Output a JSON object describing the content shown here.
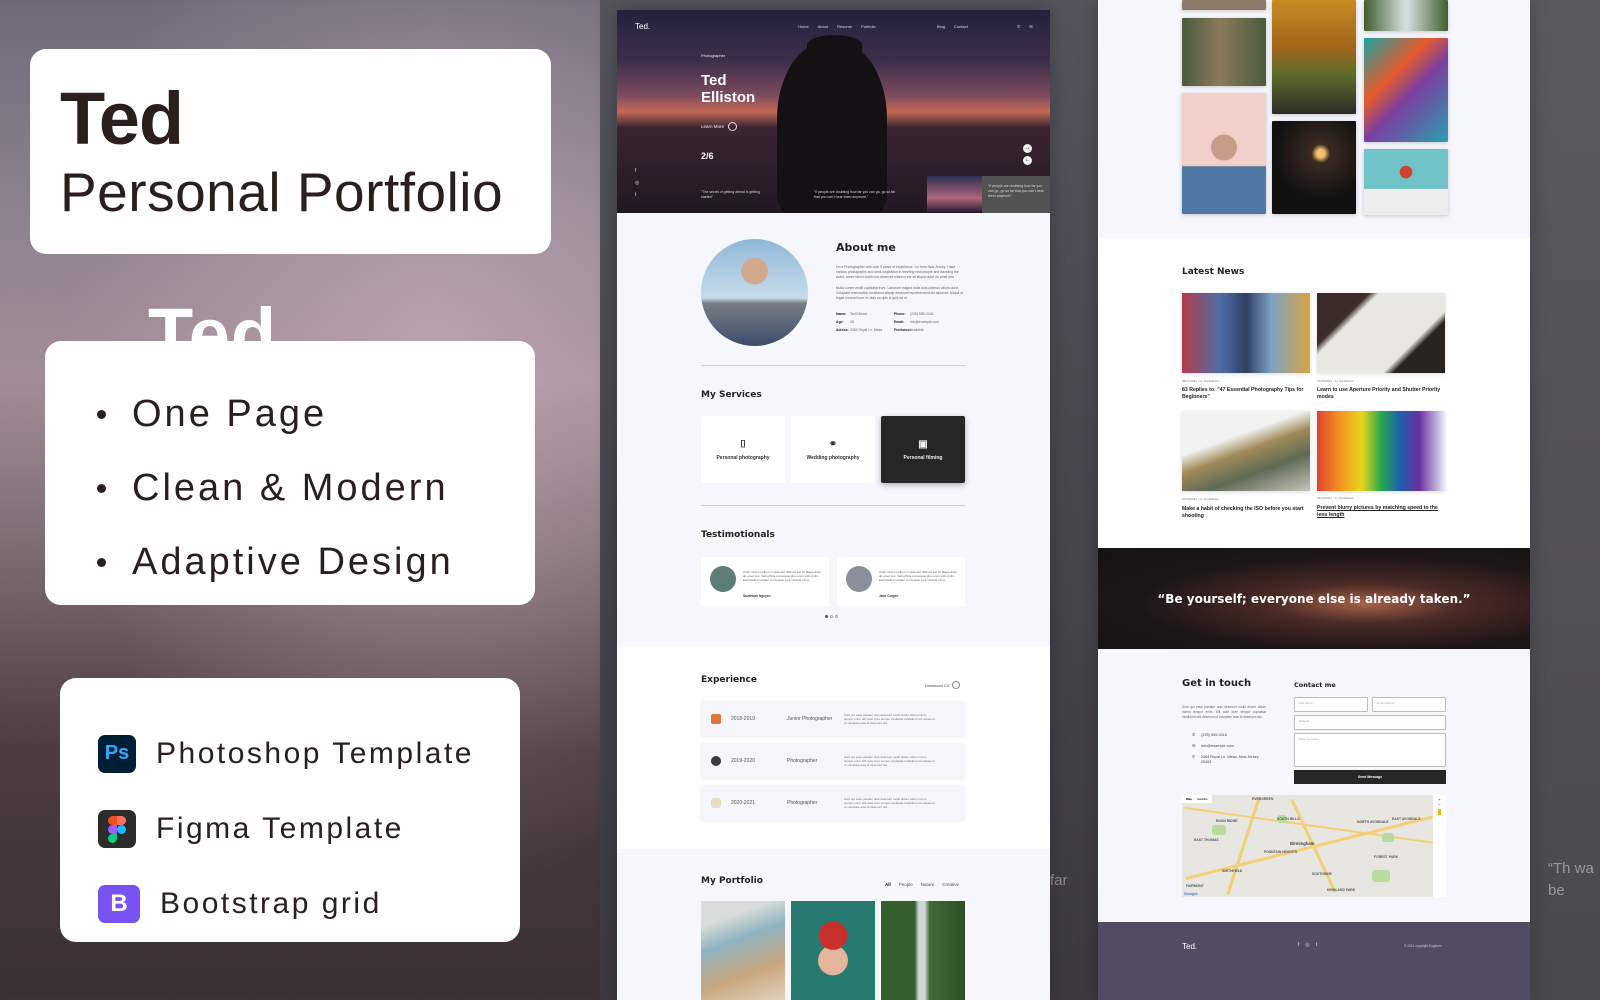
{
  "promo": {
    "title": "Ted",
    "subtitle": "Personal Portfolio",
    "ghost_title": "Ted",
    "features": [
      "One Page",
      "Clean & Modern",
      "Adaptive Design"
    ],
    "tools": [
      {
        "icon": "photoshop-icon",
        "icon_text": "Ps",
        "label": "Photoshop Template"
      },
      {
        "icon": "figma-icon",
        "icon_text": "",
        "label": "Figma Template"
      },
      {
        "icon": "bootstrap-icon",
        "icon_text": "B",
        "label": "Bootstrap grid"
      }
    ],
    "ghost_far": "far",
    "ghost_quote": "“Th wa be"
  },
  "hero": {
    "logo": "Ted.",
    "nav_left": [
      "Home",
      "About",
      "Resume",
      "Portfolio"
    ],
    "nav_right": [
      "Blog",
      "Contact"
    ],
    "role": "Photographer",
    "name": "Ted Elliston",
    "learn_more": "Learn More",
    "slide": "2/6",
    "quote_1": "\"The secret of getting ahead is getting started\"",
    "quote_2": "\"If people are doubting how far you can go, go so far that you can't hear them anymore.\"",
    "quote_3": "\"If people are doubting how far you can go, go so far that you can't hear them anymore\"",
    "social": [
      "f",
      "◎",
      "t"
    ],
    "arrow_next": "→",
    "arrow_prev": "←"
  },
  "about": {
    "title": "About me",
    "para1": "I'm a Photographer with over 5 years of experience. I'm from New Jersey, I take various photographs and seek inspiration in meeting new people and traveling the world. Amet minim mollit non deserunt ullamco est sit aliqua dolor do amet sint.",
    "para2": "Nulla Lorem mollit cupidatat irure. Laborum magna nulla duis ullamco cillum dolor. Voluptate exercitation incididunt aliquip deserunt reprehenderit elit laborum. Aliqua id fugiat nostrud irure ex duis ea quis id quis ad et.",
    "info": [
      {
        "k": "Name:",
        "v": "Ted Elliston",
        "k2": "Phone:",
        "v2": "(225) 555-0118"
      },
      {
        "k": "Age:",
        "v": "28",
        "k2": "Email:",
        "v2": "info@example.com"
      },
      {
        "k": "Adress:",
        "v": "2464 Royal Ln. Mesa",
        "k2": "Freelance:",
        "v2": "Available"
      }
    ]
  },
  "services": {
    "title": "My Services",
    "items": [
      {
        "icon": "camera-icon",
        "glyph": "📷",
        "label": "Personal photography"
      },
      {
        "icon": "wedding-couple-icon",
        "glyph": "👫",
        "label": "Wedding photography"
      },
      {
        "icon": "video-camera-icon",
        "glyph": "🎥",
        "label": "Personal filming"
      }
    ]
  },
  "testimonials": {
    "title": "Testimotionals",
    "items": [
      {
        "text": "Amet minim mollit non deserunt ullamco est sit aliqua dolor do amet sint. Velit officia consequat duis enim velit mollit. Exercitation veniam consequat sunt nostrud amet.",
        "name": "Savannah Nguyen"
      },
      {
        "text": "Amet minim mollit non deserunt ullamco est sit aliqua dolor do amet sint. Velit officia consequat duis enim velit mollit. Exercitation veniam consequat sunt nostrud amet.",
        "name": "Jane Cooper"
      }
    ],
    "pager_count": 3,
    "pager_active": 1
  },
  "experience": {
    "title": "Experience",
    "download": "Download CV",
    "items": [
      {
        "years": "2018-2019",
        "role": "Junior Photographer",
        "desc": "Sunt qui esse pariatur duis deserunt mollit dolore cillum minim tempor enim. Elit aute irure tempor cupidatat incididunt sint deserunt ut voluptate aute id deserunt nisi.",
        "color": "#e0763a"
      },
      {
        "years": "2019-2020",
        "role": "Photographer",
        "desc": "Sunt qui esse pariatur duis deserunt mollit dolore cillum minim tempor enim. Elit aute irure tempor cupidatat incididunt sint deserunt ut voluptate aute id deserunt nisi.",
        "color": "#3b3b3b"
      },
      {
        "years": "2020-2021",
        "role": "Photographer",
        "desc": "Sunt qui esse pariatur duis deserunt mollit dolore cillum minim tempor enim. Elit aute irure tempor cupidatat incididunt sint deserunt ut voluptate aute id deserunt nisi.",
        "color": "#e9dcc4"
      }
    ]
  },
  "portfolio": {
    "title": "My Portfolio",
    "filters": [
      "All",
      "People",
      "Nature",
      "Creative"
    ],
    "active_filter": "All"
  },
  "news": {
    "title": "Latest News",
    "items": [
      {
        "meta": "08/17/2021 · by Ted Elliston",
        "title": "83 Replies to: \"47 Essential Photography Tips for Beginners\""
      },
      {
        "meta": "07/25/2021 · by Ted Elliston",
        "title": "Learn to use Aperture Priority and Shutter Priority modes"
      },
      {
        "meta": "07/10/2021 · by Ted Elliston",
        "title": "Make a habit of checking the ISO before you start shooting"
      },
      {
        "meta": "06/10/2021 · by Ted Elliston",
        "title": "Prevent blurry pictures by matching speed to the lens length"
      }
    ]
  },
  "quote": {
    "text": "“Be yourself; everyone else is already taken.”"
  },
  "contact": {
    "title": "Get in touch",
    "text": "Sunt qui esse pariatur duis deserunt mollit dolore cillum minim tempor enim. Elit aute irure tempor cupidatat incididunt sint deserunt ut voluptate aute id deserunt nisi.",
    "phone": "(225) 555-0118",
    "email": "info@example.com",
    "address": "2464 Royal Ln. Mesa, New Jersey 45463",
    "form_title": "Contact me",
    "fullname_placeholder": "Full Name",
    "email_placeholder": "Email adress",
    "subject_placeholder": "Subject",
    "message_placeholder": "Write message",
    "send": "Send Message"
  },
  "map": {
    "toggle": [
      "Map",
      "Satellite"
    ],
    "city": "Birmingham",
    "labels": [
      "EVERGREEN",
      "SOUTH HILLS",
      "ENON RIDGE",
      "EAST THOMAS",
      "NORTH AVONDALE",
      "EAST AVONDALE",
      "FOUNTAIN HEIGHTS",
      "SMITHFIELD",
      "SOUTHSIDE",
      "FOREST PARK",
      "HIGHLAND PARK",
      "FAIRMONT"
    ],
    "brand": "Google",
    "zoom_in": "+",
    "zoom_out": "−"
  },
  "footer": {
    "logo": "Ted.",
    "social": [
      "f",
      "◎",
      "t"
    ],
    "copyright": "© 2021 copyright Eugenes"
  }
}
